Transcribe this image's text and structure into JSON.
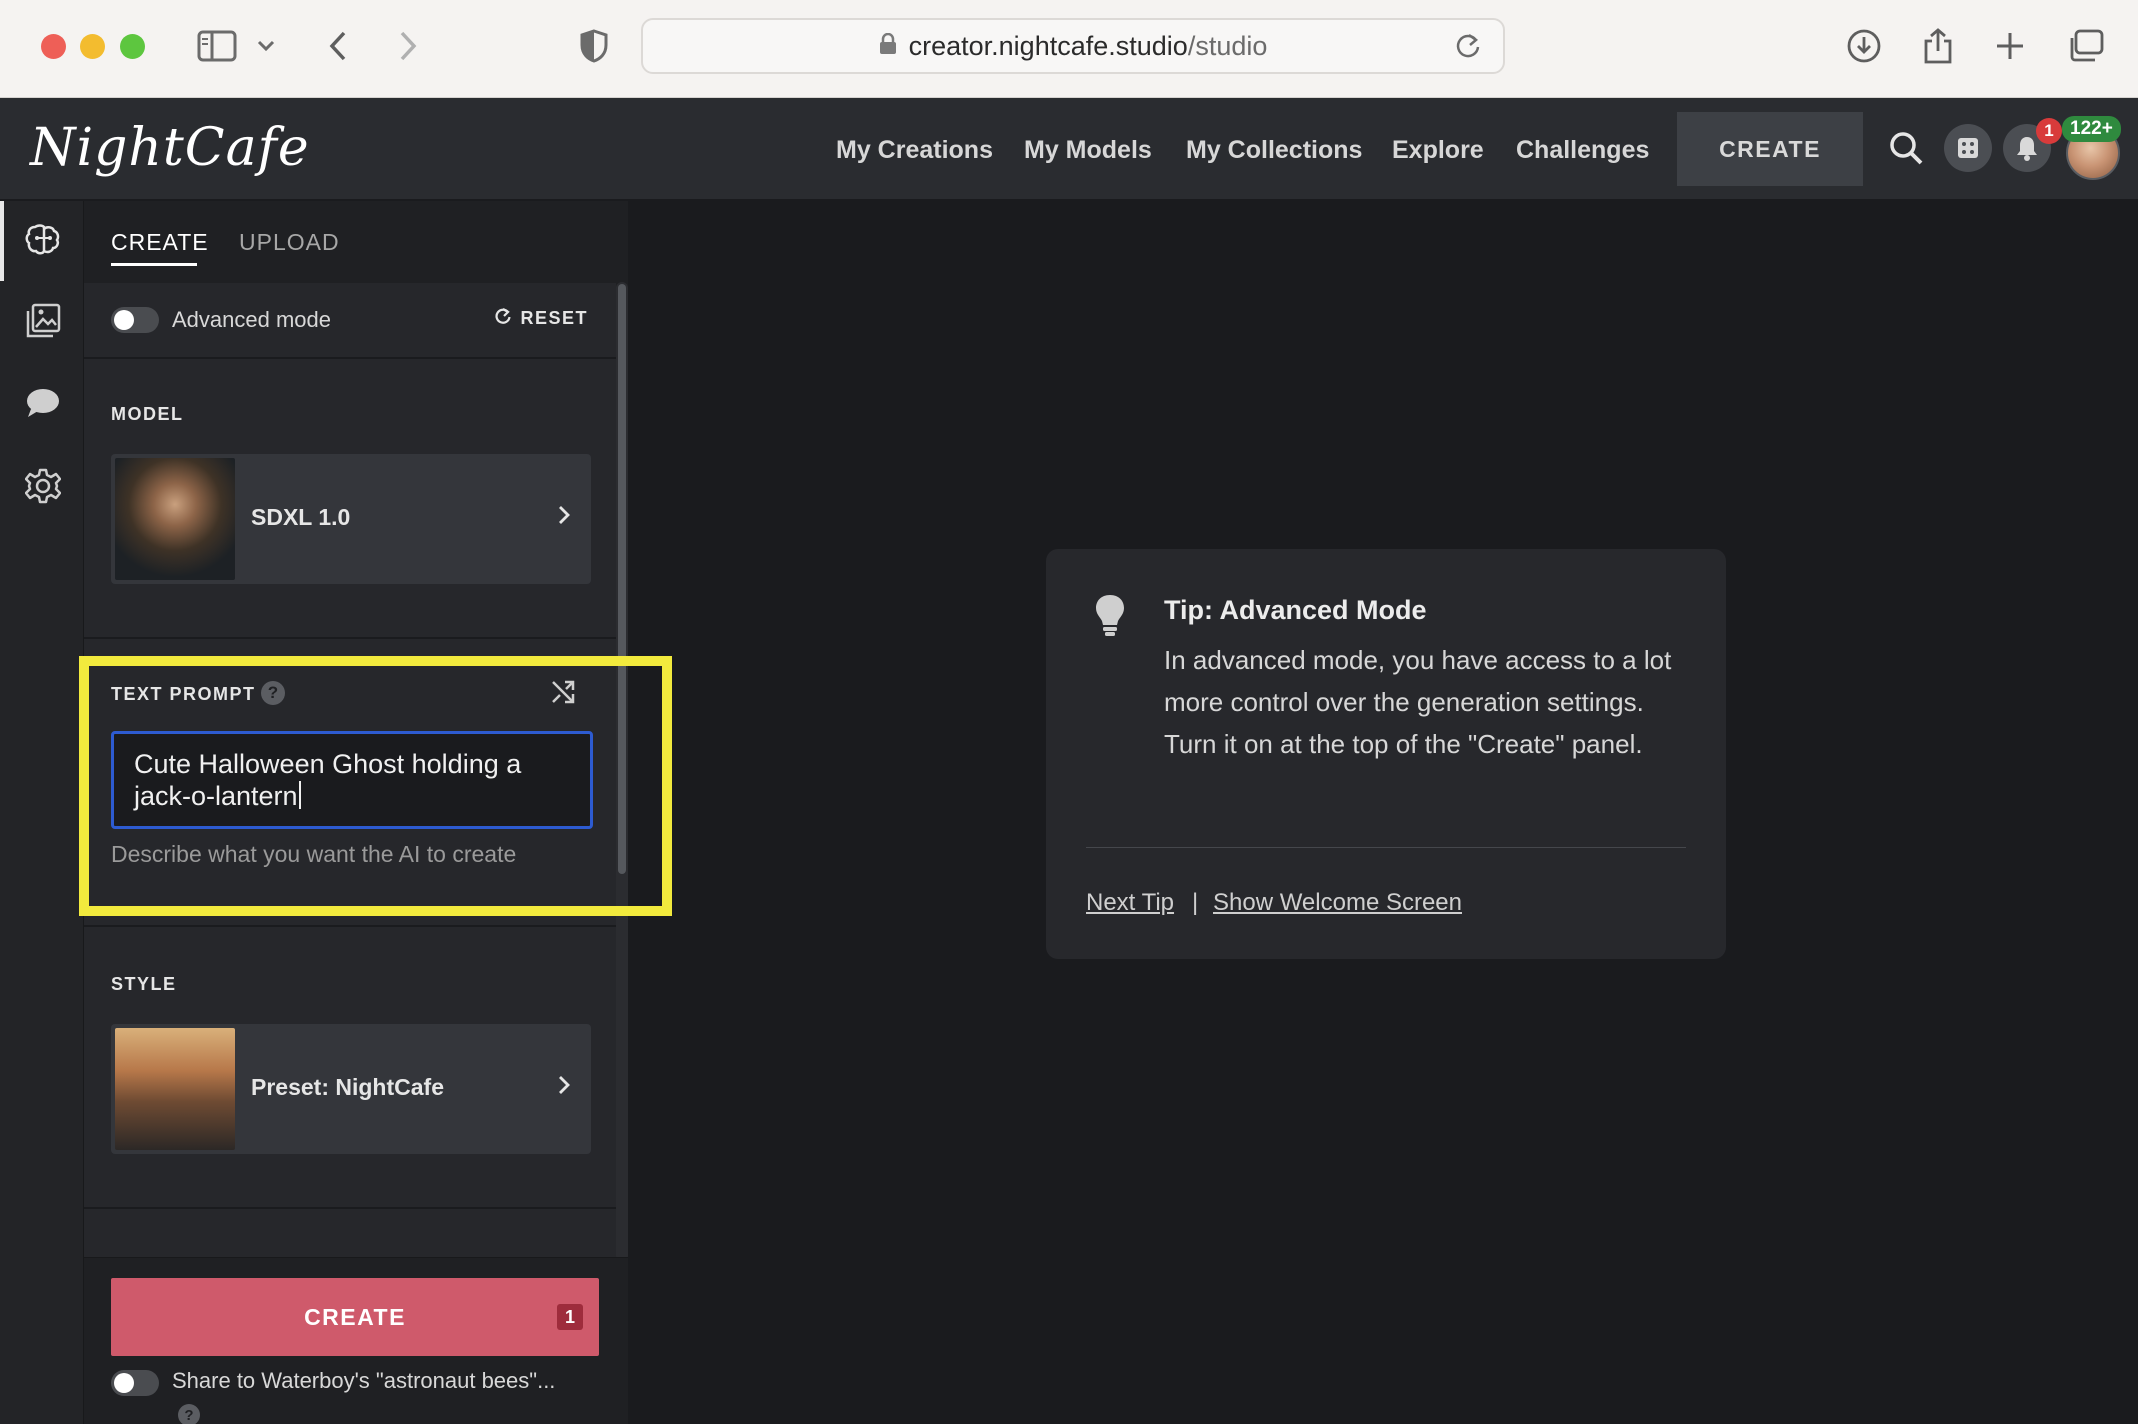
{
  "browser": {
    "url_host": "creator.nightcafe.studio",
    "url_path": "/studio"
  },
  "header": {
    "logo": "NightCafe",
    "nav": [
      "My Creations",
      "My Models",
      "My Collections",
      "Explore",
      "Challenges"
    ],
    "create_label": "CREATE",
    "notification_count": "1",
    "credits_badge": "122+"
  },
  "panel": {
    "tabs": [
      "CREATE",
      "UPLOAD"
    ],
    "advanced_mode_label": "Advanced mode",
    "reset_label": "RESET",
    "model": {
      "heading": "MODEL",
      "name": "SDXL 1.0"
    },
    "prompt": {
      "heading": "TEXT PROMPT",
      "help": "?",
      "value_line1": "Cute Halloween Ghost holding a",
      "value_line2": "jack-o-lantern",
      "hint": "Describe what you want the AI to create"
    },
    "style": {
      "heading": "STYLE",
      "name": "Preset: NightCafe"
    },
    "create_button": "CREATE",
    "create_count": "1",
    "share_label": "Share to Waterboy's \"astronaut bees\"...",
    "share_help": "?"
  },
  "tip": {
    "title": "Tip: Advanced Mode",
    "body": "In advanced mode, you have access to a lot more control over the generation settings. Turn it on at the top of the \"Create\" panel.",
    "next_tip": "Next Tip",
    "separator": "|",
    "welcome": "Show Welcome Screen"
  },
  "colors": {
    "accent_create": "#cf5a6b",
    "highlight": "#f2ea3d",
    "focus_border": "#2d5bd1"
  }
}
